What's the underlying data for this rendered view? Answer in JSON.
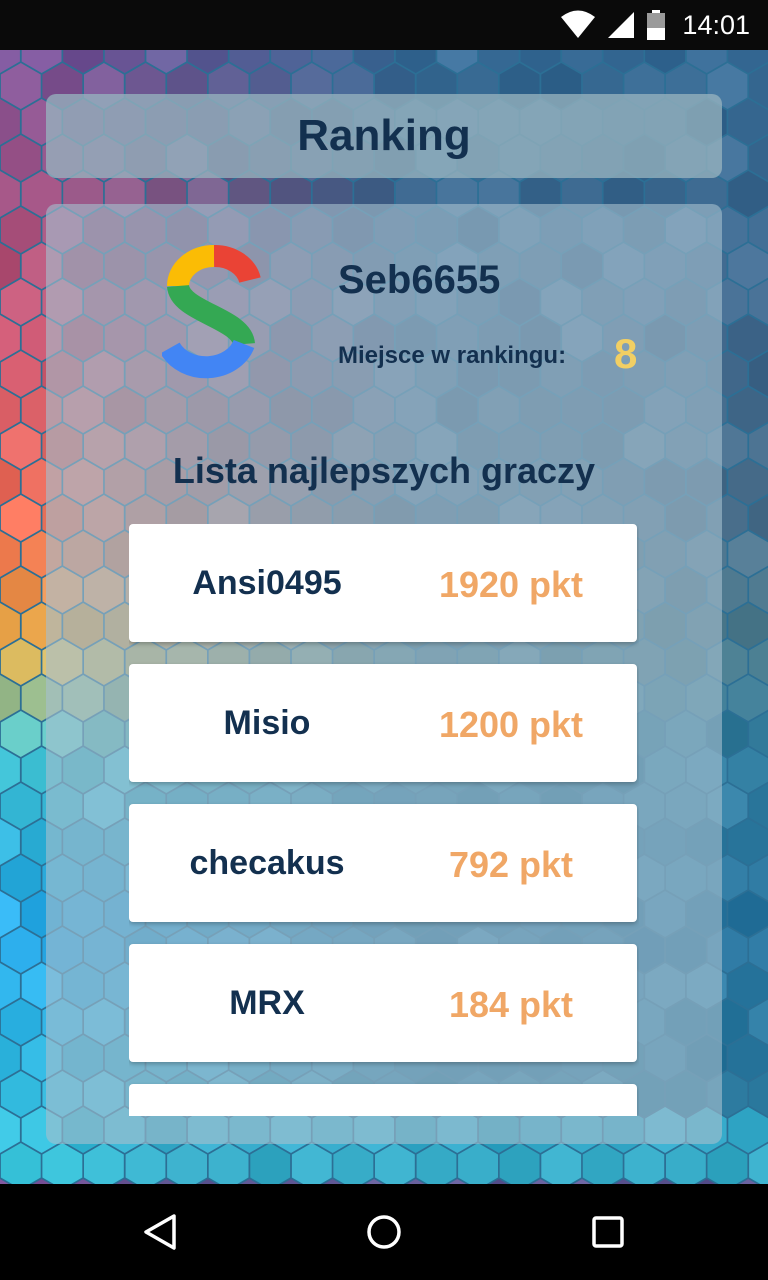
{
  "status_bar": {
    "time": "14:01",
    "icons": [
      "wifi-icon",
      "signal-icon",
      "battery-icon"
    ]
  },
  "header": {
    "title": "Ranking"
  },
  "profile": {
    "avatar_icon": "s-logo-icon",
    "username": "Seb6655",
    "rank_label": "Miejsce w rankingu:",
    "rank_value": "8"
  },
  "leaderboard": {
    "title": "Lista najlepszych graczy",
    "players": [
      {
        "name": "Ansi0495",
        "score": "1920 pkt"
      },
      {
        "name": "Misio",
        "score": "1200 pkt"
      },
      {
        "name": "checakus",
        "score": "792 pkt"
      },
      {
        "name": "MRX",
        "score": "184 pkt"
      },
      {
        "name": "",
        "score": ""
      }
    ]
  },
  "nav_bar": {
    "buttons": [
      "back-icon",
      "home-icon",
      "recents-icon"
    ]
  },
  "colors": {
    "title": "#13304f",
    "score": "#f0a766",
    "rank": "#f2cf63",
    "background": "#2c6f95"
  }
}
